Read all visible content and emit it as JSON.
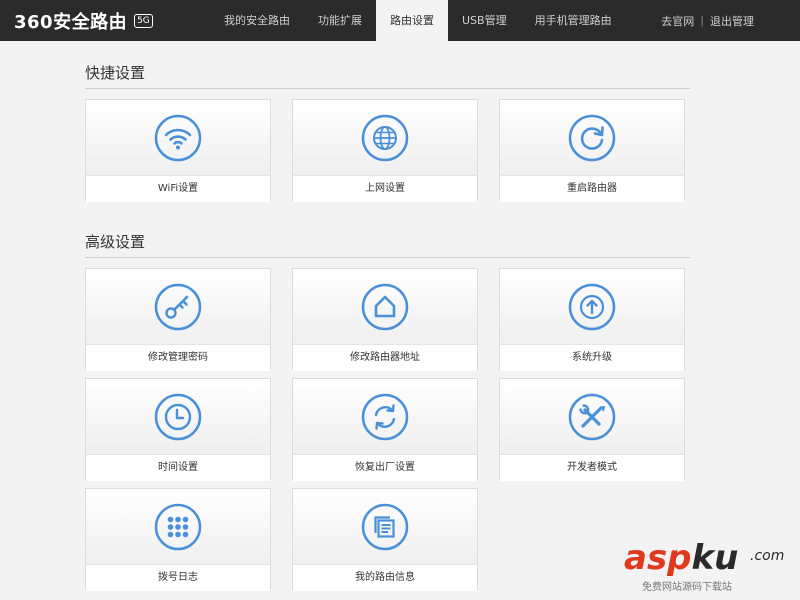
{
  "brand": {
    "name": "360安全路由",
    "badge": "5G"
  },
  "nav": {
    "tabs": [
      {
        "label": "我的安全路由",
        "active": false
      },
      {
        "label": "功能扩展",
        "active": false
      },
      {
        "label": "路由设置",
        "active": true
      },
      {
        "label": "USB管理",
        "active": false
      },
      {
        "label": "用手机管理路由",
        "active": false
      }
    ],
    "links": {
      "home": "去官网",
      "separator": "|",
      "logout": "退出管理"
    }
  },
  "quick_settings": {
    "title": "快捷设置",
    "cards": [
      {
        "label": "WiFi设置",
        "icon": "wifi-icon"
      },
      {
        "label": "上网设置",
        "icon": "globe-icon"
      },
      {
        "label": "重启路由器",
        "icon": "restart-icon"
      }
    ]
  },
  "advanced_settings": {
    "title": "高级设置",
    "cards": [
      {
        "label": "修改管理密码",
        "icon": "key-icon"
      },
      {
        "label": "修改路由器地址",
        "icon": "home-icon"
      },
      {
        "label": "系统升级",
        "icon": "upgrade-icon"
      },
      {
        "label": "时间设置",
        "icon": "clock-icon"
      },
      {
        "label": "恢复出厂设置",
        "icon": "factory-reset-icon"
      },
      {
        "label": "开发者模式",
        "icon": "tools-icon"
      },
      {
        "label": "拨号日志",
        "icon": "keypad-icon"
      },
      {
        "label": "我的路由信息",
        "icon": "info-document-icon"
      }
    ]
  },
  "watermark": {
    "main": "asp",
    "main_accent": "ku",
    "suffix": ".com",
    "sub": "免费网站源码下载站"
  },
  "colors": {
    "topbar": "#2b2b2b",
    "accent": "#4a90d9",
    "page_bg": "#f3f3f3"
  }
}
